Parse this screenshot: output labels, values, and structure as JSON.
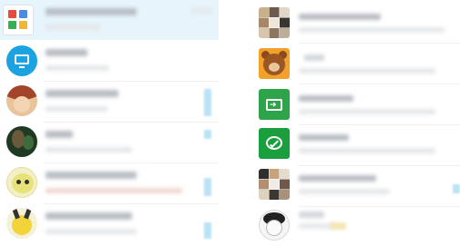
{
  "left_conversations": [
    {
      "avatar": "app-grid-icon",
      "active": true,
      "has_badge": false
    },
    {
      "avatar": "monitor-icon",
      "active": false,
      "has_badge": false
    },
    {
      "avatar": "anime-avatar-brown",
      "active": false,
      "has_badge": true
    },
    {
      "avatar": "photo-avatar-green",
      "active": false,
      "has_badge": true
    },
    {
      "avatar": "cartoon-avatar-yellow",
      "active": false,
      "has_badge": true
    },
    {
      "avatar": "pikachu-avatar",
      "active": false,
      "has_badge": true
    }
  ],
  "right_conversations": [
    {
      "avatar": "photo-grid-avatar",
      "has_badge": false
    },
    {
      "avatar": "bear-avatar",
      "has_badge": false
    },
    {
      "avatar": "folder-transfer-icon",
      "has_badge": false
    },
    {
      "avatar": "chat-bubble-icon",
      "has_badge": false
    },
    {
      "avatar": "photo-grid-avatar-2",
      "has_badge": true
    },
    {
      "avatar": "sketch-avatar",
      "has_badge": false
    }
  ],
  "colors": {
    "active_row": "#e6f4fc",
    "badge": "#b9e3f5",
    "monitor_icon": "#1aa3e0",
    "folder_icon": "#2fa34a",
    "chat_icon": "#1a9e3e",
    "bear_bg": "#f2a22a"
  }
}
